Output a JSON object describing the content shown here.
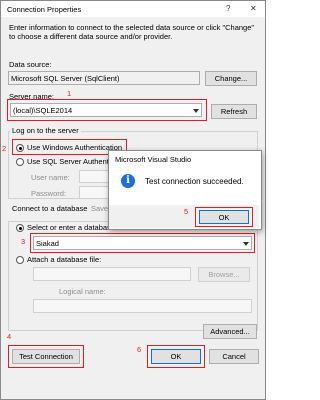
{
  "window": {
    "title": "Connection Properties",
    "help_glyph": "?",
    "close_glyph": "✕"
  },
  "intro": "Enter information to connect to the selected data source or click \"Change\" to choose a different data source and/or provider.",
  "data_source": {
    "label": "Data source:",
    "value": "Microsoft SQL Server (SqlClient)",
    "change_button": "Change..."
  },
  "server": {
    "label": "Server name:",
    "value": "(local)\\SQLE2014",
    "refresh_button": "Refresh"
  },
  "logon": {
    "group_label": "Log on to the server",
    "windows_auth": "Use Windows Authentication",
    "sql_auth": "Use SQL Server Authentication",
    "user_name_label": "User name:",
    "password_label": "Password:",
    "save_password": "Save my"
  },
  "database": {
    "group_label": "Connect to a database",
    "select_option": "Select or enter a database name:",
    "selected_db": "Siakad",
    "attach_option": "Attach a database file:",
    "browse_button": "Browse...",
    "logical_name_label": "Logical name:"
  },
  "buttons": {
    "advanced": "Advanced...",
    "test_connection": "Test Connection",
    "ok": "OK",
    "cancel": "Cancel"
  },
  "message_box": {
    "title": "Microsoft Visual Studio",
    "icon": "info-icon",
    "message": "Test connection succeeded.",
    "ok": "OK"
  },
  "annotations": {
    "n1": "1",
    "n2": "2",
    "n3": "3",
    "n4": "4",
    "n5": "5",
    "n6": "6"
  },
  "colors": {
    "annotation": "#e31b23",
    "info_icon": "#1e6fd9"
  }
}
